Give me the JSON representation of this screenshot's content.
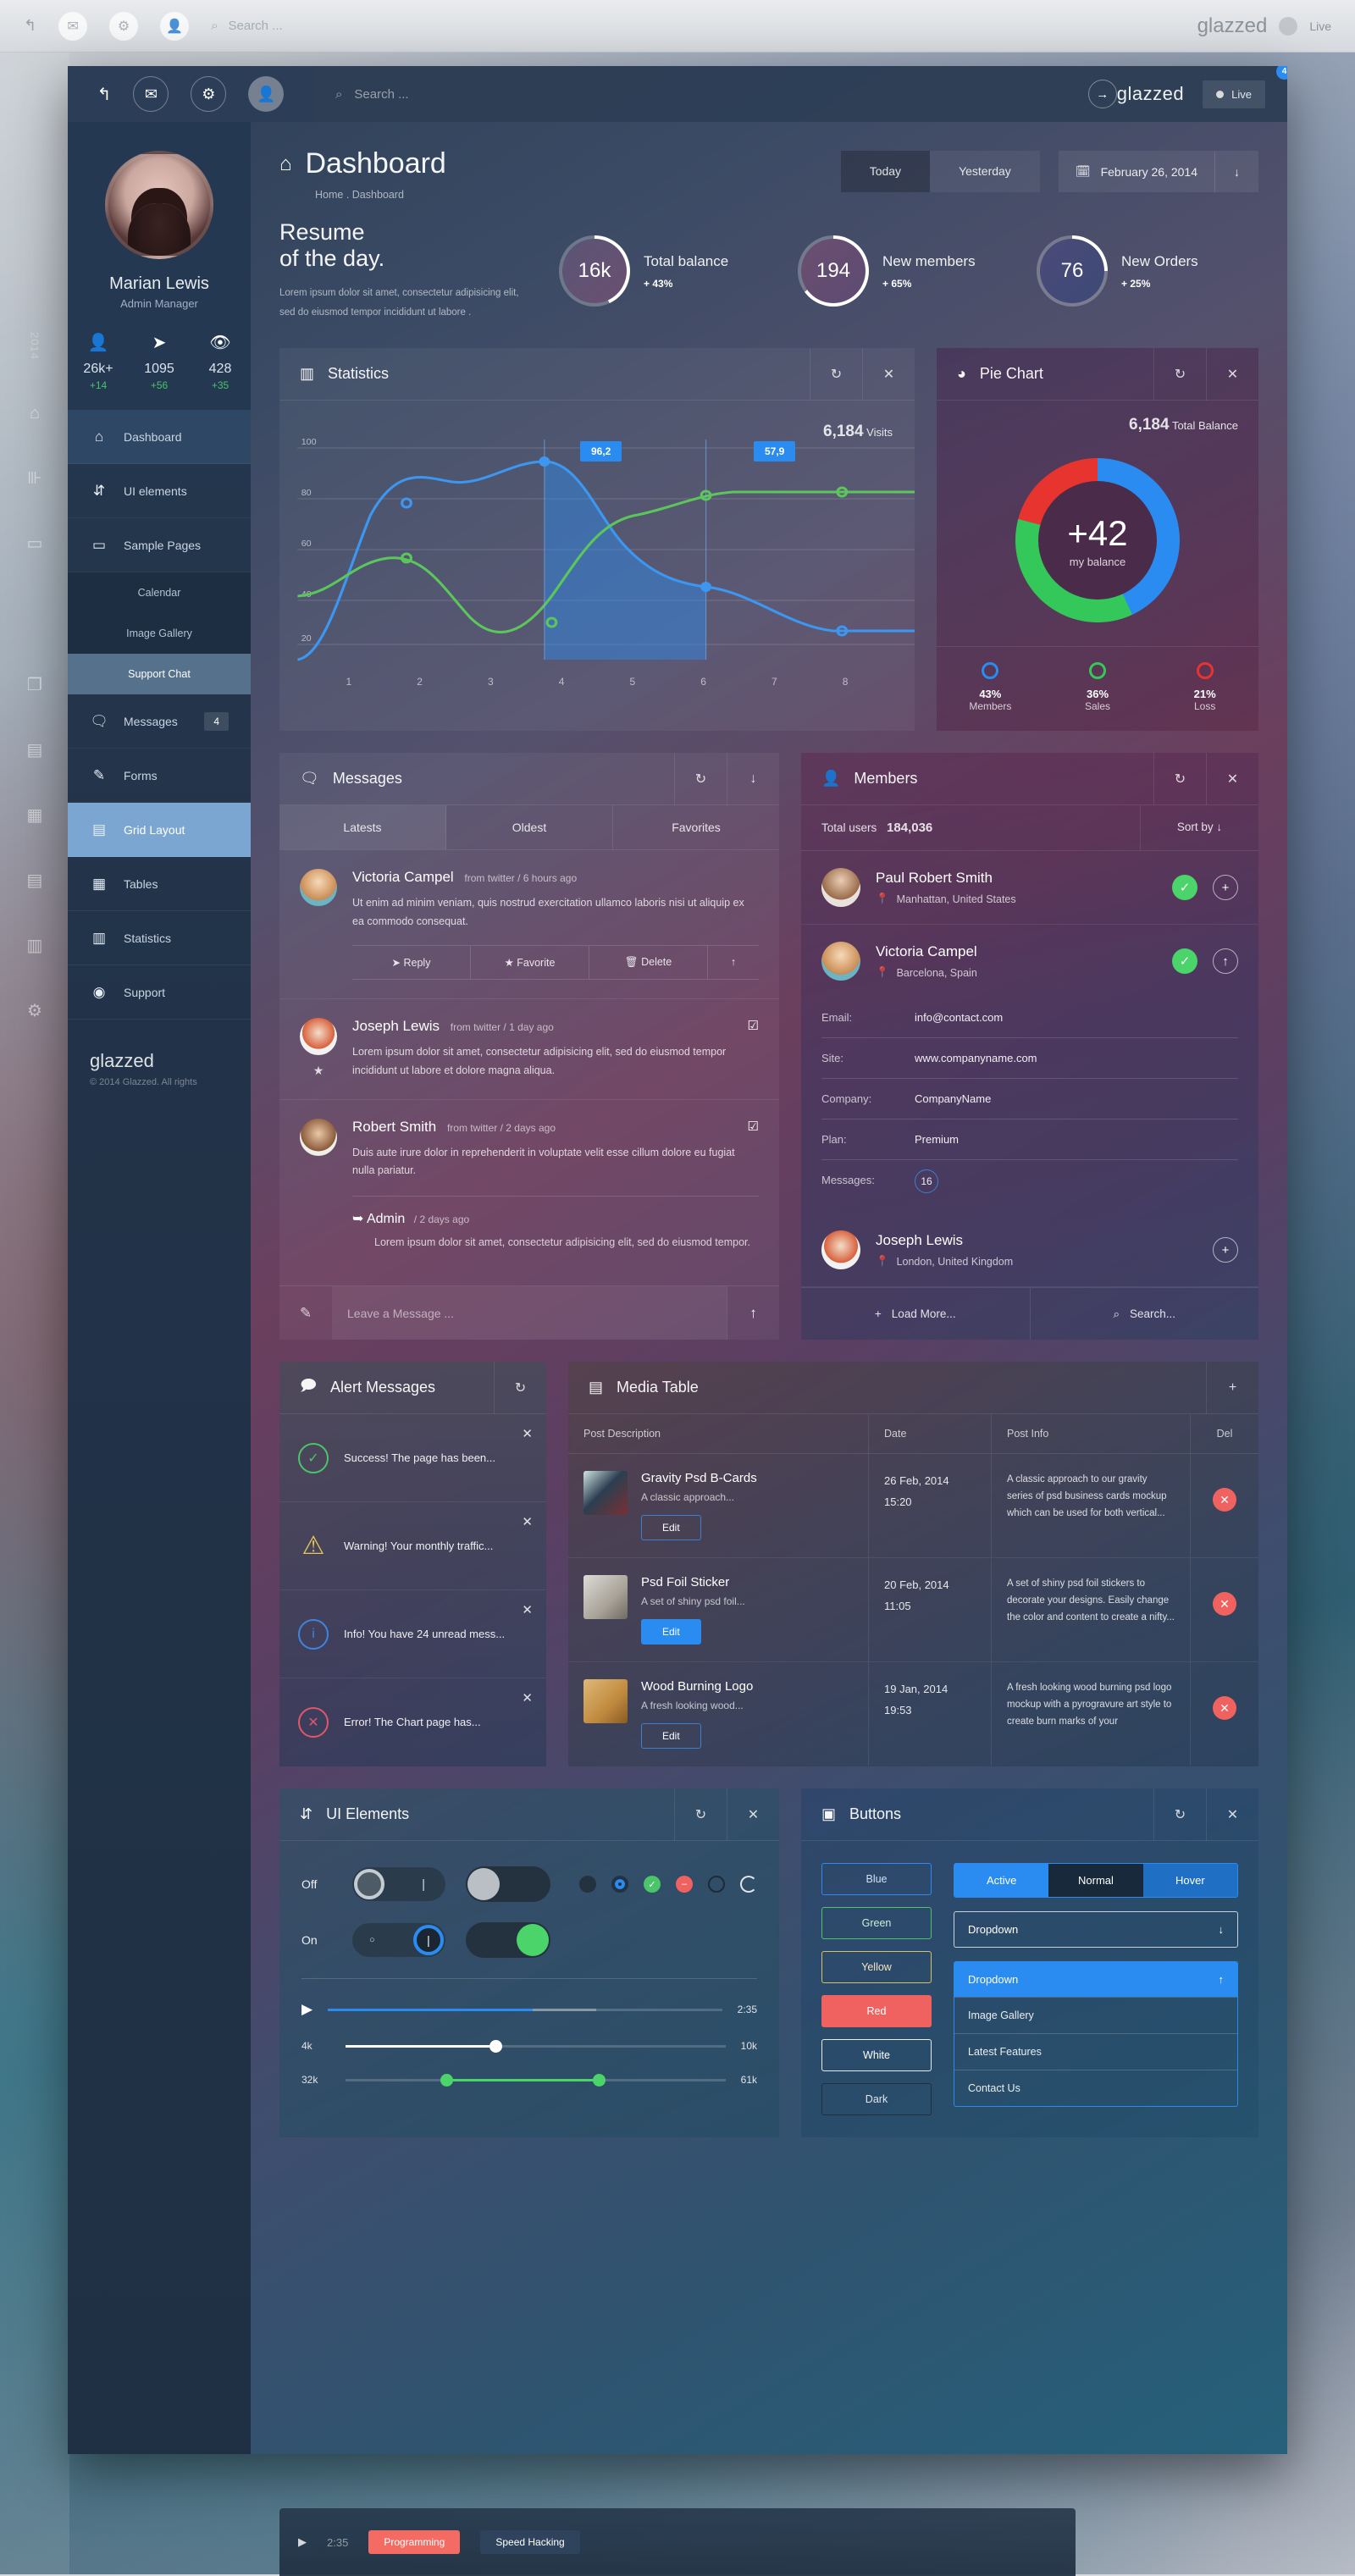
{
  "desktop": {
    "search_placeholder": "Search ...",
    "brand": "glazzed",
    "live_label": "Live",
    "rail_text": "2014",
    "peek": {
      "label1": "Programming",
      "label2": "Speed Hacking"
    }
  },
  "topbar": {
    "mail_badge": "4",
    "search_placeholder": "Search ...",
    "brand": "glazzed",
    "live_label": "Live"
  },
  "sidebar": {
    "user": {
      "name": "Marian Lewis",
      "role": "Admin Manager"
    },
    "stats": [
      {
        "icon": "user-icon",
        "value": "26k+",
        "delta": "+14"
      },
      {
        "icon": "send-icon",
        "value": "1095",
        "delta": "+56"
      },
      {
        "icon": "eye-icon",
        "value": "428",
        "delta": "+35"
      }
    ],
    "items": [
      {
        "label": "Dashboard",
        "icon": "home-icon",
        "state": "active"
      },
      {
        "label": "UI elements",
        "icon": "sliders-icon",
        "state": ""
      },
      {
        "label": "Sample Pages",
        "icon": "monitor-icon",
        "state": ""
      },
      {
        "label": "Messages",
        "icon": "chat-icon",
        "state": "",
        "badge": "4"
      },
      {
        "label": "Forms",
        "icon": "edit-icon",
        "state": ""
      },
      {
        "label": "Grid Layout",
        "icon": "layout-icon",
        "state": "highlight"
      },
      {
        "label": "Tables",
        "icon": "table-icon",
        "state": ""
      },
      {
        "label": "Statistics",
        "icon": "bars-icon",
        "state": ""
      },
      {
        "label": "Support",
        "icon": "support-icon",
        "state": ""
      }
    ],
    "subitems": [
      {
        "label": "Calendar",
        "selected": false
      },
      {
        "label": "Image Gallery",
        "selected": false
      },
      {
        "label": "Support Chat",
        "selected": true
      }
    ],
    "footer": {
      "brand": "glazzed",
      "copyright": "© 2014 Glazzed. All rights"
    }
  },
  "hero": {
    "title": "Dashboard",
    "breadcrumb": "Home . Dashboard",
    "segments": [
      {
        "label": "Today",
        "active": true
      },
      {
        "label": "Yesterday",
        "active": false
      }
    ],
    "date": "February 26, 2014"
  },
  "resume": {
    "heading_line1": "Resume",
    "heading_line2": "of the day.",
    "body": "Lorem ipsum dolor sit amet, consectetur adipisicing elit, sed do eiusmod tempor incididunt ut labore .",
    "gauges": [
      {
        "value": "16k",
        "label": "Total balance",
        "pct": "+ 43%",
        "arc": 43
      },
      {
        "value": "194",
        "label": "New members",
        "pct": "+ 65%",
        "arc": 65
      },
      {
        "value": "76",
        "label": "New Orders",
        "pct": "+ 25%",
        "arc": 25
      }
    ]
  },
  "statistics": {
    "title": "Statistics",
    "icon": "bars-icon",
    "actions": [
      "refresh-icon",
      "close-icon"
    ],
    "visits_value": "6,184",
    "visits_label": "Visits",
    "tooltips": [
      "96,2",
      "57,9"
    ]
  },
  "chart_data": [
    {
      "type": "line",
      "title": "Statistics",
      "x": [
        1,
        2,
        3,
        4,
        5,
        6,
        7,
        8
      ],
      "xlabel": "",
      "ylabel": "",
      "ylim": [
        0,
        110
      ],
      "yticks": [
        20,
        40,
        60,
        80,
        100
      ],
      "grid": true,
      "legend": "none",
      "annotations": [
        "96,2",
        "57,9",
        "6,184 Visits"
      ],
      "series": [
        {
          "name": "Blue",
          "color": "#2a8cf0",
          "values": [
            8,
            74,
            86,
            96.2,
            80,
            57.9,
            44,
            37
          ]
        },
        {
          "name": "Green",
          "color": "#5cc65c",
          "values": [
            37,
            55,
            47,
            30,
            58,
            76,
            86,
            89
          ]
        }
      ]
    },
    {
      "type": "pie",
      "title": "Pie Chart",
      "total_value": "6,184",
      "total_label": "Total Balance",
      "center_value": "+42",
      "center_label": "my balance",
      "labels": [
        "Members",
        "Sales",
        "Loss"
      ],
      "values": [
        43,
        36,
        21
      ],
      "colors": [
        "#2a8cf0",
        "#34c759",
        "#e8342f"
      ]
    }
  ],
  "pie": {
    "title": "Pie Chart",
    "icon": "pie-icon",
    "actions": [
      "refresh-icon",
      "close-icon"
    ],
    "total_value": "6,184",
    "total_label": "Total Balance",
    "center_value": "+42",
    "center_label": "my balance",
    "legend": [
      {
        "pct": "43%",
        "name": "Members",
        "color": "#2a8cf0"
      },
      {
        "pct": "36%",
        "name": "Sales",
        "color": "#34c759"
      },
      {
        "pct": "21%",
        "name": "Loss",
        "color": "#e8342f"
      }
    ]
  },
  "messages": {
    "title": "Messages",
    "icon": "chat-icon",
    "actions": [
      "refresh-icon",
      "down-icon"
    ],
    "tabs": [
      {
        "label": "Latests",
        "active": true
      },
      {
        "label": "Oldest",
        "active": false
      },
      {
        "label": "Favorites",
        "active": false
      }
    ],
    "items": [
      {
        "name": "Victoria Campel",
        "meta": "from twitter  /  6 hours ago",
        "text": "Ut enim ad minim veniam, quis nostrud exercitation ullamco laboris nisi ut aliquip ex ea commodo consequat.",
        "actions": [
          "Reply",
          "Favorite",
          "Delete"
        ]
      },
      {
        "name": "Joseph Lewis",
        "meta": "from twitter  /  1 day ago",
        "text": "Lorem ipsum dolor sit amet, consectetur adipisicing elit, sed do eiusmod tempor incididunt ut labore et dolore magna aliqua."
      },
      {
        "name": "Robert Smith",
        "meta": "from twitter  /  2 days ago",
        "text": "Duis aute irure dolor in reprehenderit in voluptate velit esse cillum dolore eu fugiat nulla pariatur.",
        "reply_name": "Admin",
        "reply_meta": "/ 2 days ago",
        "reply_text": "Lorem ipsum dolor sit amet, consectetur adipisicing elit, sed do eiusmod tempor."
      }
    ],
    "composer_placeholder": "Leave a Message ..."
  },
  "members": {
    "title": "Members",
    "icon": "user-icon",
    "actions": [
      "refresh-icon",
      "close-icon"
    ],
    "total_label": "Total users",
    "total_value": "184,036",
    "sort_label": "Sort by",
    "items": [
      {
        "name": "Paul Robert Smith",
        "location": "Manhattan, United States",
        "verified": true,
        "action": "+"
      },
      {
        "name": "Victoria Campel",
        "location": "Barcelona, Spain",
        "verified": true,
        "action": "↑"
      },
      {
        "name": "Joseph Lewis",
        "location": "London, United Kingdom",
        "verified": false,
        "action": "+"
      }
    ],
    "details": [
      {
        "key": "Email:",
        "value": "info@contact.com"
      },
      {
        "key": "Site:",
        "value": "www.companyname.com"
      },
      {
        "key": "Company:",
        "value": "CompanyName"
      },
      {
        "key": "Plan:",
        "value": "Premium"
      },
      {
        "key": "Messages:",
        "value": "16",
        "pill": true
      }
    ],
    "footer": {
      "load_more": "Load More...",
      "search": "Search..."
    }
  },
  "alerts": {
    "title": "Alert Messages",
    "icon": "alert-chat-icon",
    "actions": [
      "refresh-icon"
    ],
    "items": [
      {
        "kind": "success",
        "icon": "check-icon",
        "text": "Success! The page has been..."
      },
      {
        "kind": "warning",
        "icon": "warning-icon",
        "text": "Warning! Your monthly traffic..."
      },
      {
        "kind": "info",
        "icon": "info-icon",
        "text": "Info! You have 24 unread mess..."
      },
      {
        "kind": "error",
        "icon": "error-icon",
        "text": "Error! The Chart page has..."
      }
    ]
  },
  "media": {
    "title": "Media Table",
    "icon": "media-icon",
    "actions": [
      "plus-icon"
    ],
    "columns": [
      "Post Description",
      "Date",
      "Post Info",
      "Del"
    ],
    "rows": [
      {
        "title": "Gravity Psd B-Cards",
        "subtitle": "A classic approach...",
        "edit": "Edit",
        "edit_style": "outline",
        "date": "26 Feb, 2014",
        "time": "15:20",
        "info": "A classic approach to our gravity series of psd business cards mockup which can be used for both vertical..."
      },
      {
        "title": "Psd Foil Sticker",
        "subtitle": "A set of shiny psd foil...",
        "edit": "Edit",
        "edit_style": "filled",
        "date": "20 Feb, 2014",
        "time": "11:05",
        "info": "A set of shiny psd foil stickers to decorate your designs. Easily change the color and content to create a nifty..."
      },
      {
        "title": "Wood Burning Logo",
        "subtitle": "A fresh looking wood...",
        "edit": "Edit",
        "edit_style": "outline",
        "date": "19 Jan, 2014",
        "time": "19:53",
        "info": "A fresh looking wood burning psd logo mockup with a pyrogravure art style to create burn marks of your"
      }
    ]
  },
  "ui_elements": {
    "title": "UI Elements",
    "icon": "sliders-icon",
    "actions": [
      "refresh-icon",
      "close-icon"
    ],
    "toggle_off_label": "Off",
    "toggle_on_label": "On",
    "sliders": [
      {
        "left": "",
        "right": "2:35",
        "type": "media"
      },
      {
        "left": "4k",
        "right": "10k",
        "type": "single"
      },
      {
        "left": "32k",
        "right": "61k",
        "type": "range"
      }
    ]
  },
  "buttons": {
    "title": "Buttons",
    "icon": "window-icon",
    "actions": [
      "refresh-icon",
      "close-icon"
    ],
    "color_buttons": [
      "Blue",
      "Green",
      "Yellow",
      "Red",
      "White",
      "Dark"
    ],
    "states": [
      "Active",
      "Normal",
      "Hover"
    ],
    "dropdown_closed": "Dropdown",
    "dropdown_open": "Dropdown",
    "dropdown_items": [
      "Image Gallery",
      "Latest Features",
      "Contact Us"
    ]
  }
}
